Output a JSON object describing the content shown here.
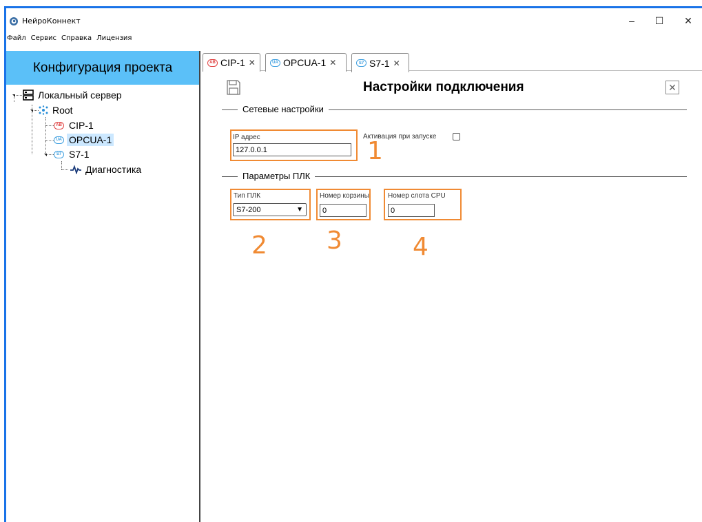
{
  "window": {
    "title": "НейроКоннект",
    "controls": {
      "minimize": "–",
      "maximize": "☐",
      "close": "✕"
    }
  },
  "menu": [
    "Файл",
    "Сервис",
    "Справка",
    "Лицензия"
  ],
  "sidebar": {
    "header": "Конфигурация проекта",
    "tree": {
      "server": "Локальный сервер",
      "root": "Root",
      "cip": {
        "badge": "AB",
        "label": "CIP-1"
      },
      "opcua": {
        "badge": "UA",
        "label": "OPCUA-1"
      },
      "s7": {
        "badge": "S7",
        "label": "S7-1"
      },
      "diag": "Диагностика"
    }
  },
  "tabs": [
    {
      "badge": "AB",
      "label": "CIP-1",
      "close": "✕"
    },
    {
      "badge": "UA",
      "label": "OPCUA-1",
      "close": "✕"
    },
    {
      "badge": "S7",
      "label": "S7-1",
      "close": "✕"
    }
  ],
  "main": {
    "title": "Настройки подключения",
    "close": "✕",
    "network": {
      "section_title": "Сетевые настройки",
      "ip_label": "IP адрес",
      "ip_value": "127.0.0.1",
      "autostart_label": "Активация при запуске",
      "autostart_checked": false
    },
    "plc": {
      "section_title": "Параметры ПЛК",
      "type_label": "Тип ПЛК",
      "type_value": "S7-200",
      "rack_label": "Номер корзины",
      "rack_value": "0",
      "slot_label": "Номер слота CPU",
      "slot_value": "0"
    }
  },
  "annotations": [
    "1",
    "2",
    "3",
    "4"
  ],
  "colors": {
    "accent_blue": "#1a73e8",
    "sidebar_header": "#5bc0f8",
    "selection": "#cce8ff",
    "highlight_orange": "#f08a33"
  }
}
